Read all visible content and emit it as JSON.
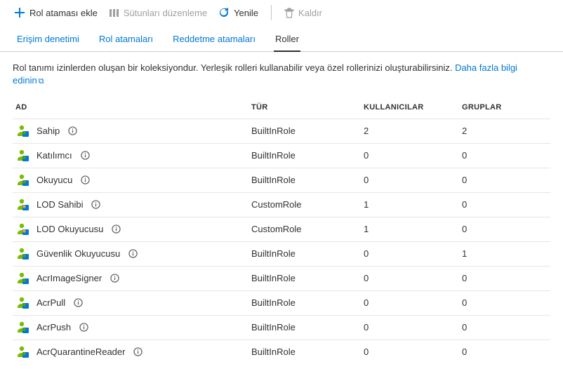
{
  "toolbar": {
    "add": "Rol ataması ekle",
    "edit_columns": "Sütunları düzenleme",
    "refresh": "Yenile",
    "remove": "Kaldır"
  },
  "tabs": [
    {
      "label": "Erişim denetimi",
      "active": false
    },
    {
      "label": "Rol atamaları",
      "active": false
    },
    {
      "label": "Reddetme atamaları",
      "active": false
    },
    {
      "label": "Roller",
      "active": true
    }
  ],
  "description": {
    "text": "Rol tanımı izinlerden oluşan bir koleksiyondur. Yerleşik rolleri kullanabilir veya özel rollerinizi oluşturabilirsiniz. ",
    "link": "Daha fazla bilgi edinin"
  },
  "columns": {
    "name": "AD",
    "type": "TÜR",
    "users": "KULLANICILAR",
    "groups": "GRUPLAR"
  },
  "roles": [
    {
      "name": "Sahip",
      "type": "BuiltInRole",
      "users": "2",
      "groups": "2",
      "custom": false
    },
    {
      "name": "Katılımcı",
      "type": "BuiltInRole",
      "users": "0",
      "groups": "0",
      "custom": false
    },
    {
      "name": "Okuyucu",
      "type": "BuiltInRole",
      "users": "0",
      "groups": "0",
      "custom": false
    },
    {
      "name": "LOD Sahibi",
      "type": "CustomRole",
      "users": "1",
      "groups": "0",
      "custom": true
    },
    {
      "name": "LOD Okuyucusu",
      "type": "CustomRole",
      "users": "1",
      "groups": "0",
      "custom": true
    },
    {
      "name": "Güvenlik Okuyucusu",
      "type": "BuiltInRole",
      "users": "0",
      "groups": "1",
      "custom": false
    },
    {
      "name": "AcrImageSigner",
      "type": "BuiltInRole",
      "users": "0",
      "groups": "0",
      "custom": false
    },
    {
      "name": "AcrPull",
      "type": "BuiltInRole",
      "users": "0",
      "groups": "0",
      "custom": false
    },
    {
      "name": "AcrPush",
      "type": "BuiltInRole",
      "users": "0",
      "groups": "0",
      "custom": false
    },
    {
      "name": "AcrQuarantineReader",
      "type": "BuiltInRole",
      "users": "0",
      "groups": "0",
      "custom": false
    }
  ]
}
